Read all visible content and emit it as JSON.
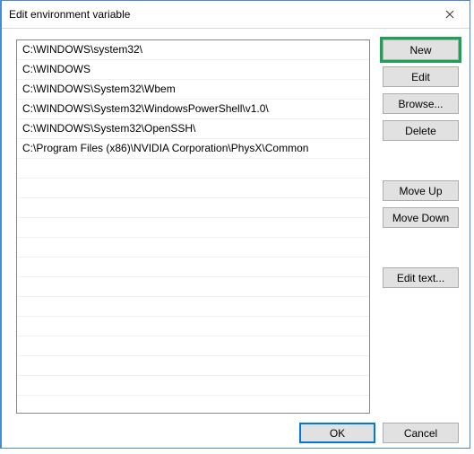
{
  "window": {
    "title": "Edit environment variable"
  },
  "list": {
    "items": [
      "C:\\WINDOWS\\system32\\",
      "C:\\WINDOWS",
      "C:\\WINDOWS\\System32\\Wbem",
      "C:\\WINDOWS\\System32\\WindowsPowerShell\\v1.0\\",
      "C:\\WINDOWS\\System32\\OpenSSH\\",
      "C:\\Program Files (x86)\\NVIDIA Corporation\\PhysX\\Common"
    ]
  },
  "buttons": {
    "new": "New",
    "edit": "Edit",
    "browse": "Browse...",
    "delete": "Delete",
    "moveup": "Move Up",
    "movedown": "Move Down",
    "edittext": "Edit text...",
    "ok": "OK",
    "cancel": "Cancel"
  }
}
